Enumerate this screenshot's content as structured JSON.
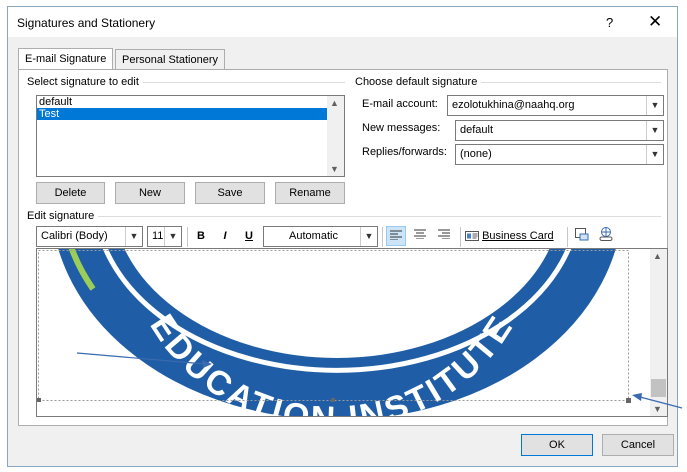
{
  "window": {
    "title": "Signatures and Stationery",
    "help_label": "?",
    "close_label": "✕"
  },
  "tabs": [
    {
      "label": "E-mail Signature",
      "active": true
    },
    {
      "label": "Personal Stationery",
      "active": false
    }
  ],
  "select_signature": {
    "heading": "Select signature to edit",
    "items": [
      {
        "label": "default",
        "selected": false
      },
      {
        "label": "Test",
        "selected": true
      }
    ],
    "buttons": {
      "delete": "Delete",
      "new": "New",
      "save": "Save",
      "rename": "Rename"
    }
  },
  "default_signature": {
    "heading": "Choose default signature",
    "email_account_label": "E-mail account:",
    "email_account_value": "ezolotukhina@naahq.org",
    "new_messages_label": "New messages:",
    "new_messages_value": "default",
    "replies_label": "Replies/forwards:",
    "replies_value": "(none)"
  },
  "edit_signature": {
    "heading": "Edit signature",
    "font_name": "Calibri (Body)",
    "font_size": "11",
    "bold": "B",
    "italic": "I",
    "underline": "U",
    "font_color": "Automatic",
    "business_card_label": "Business Card",
    "image_text": "EDUCATION INSTITUTE"
  },
  "footer": {
    "ok": "OK",
    "cancel": "Cancel"
  },
  "colors": {
    "accent": "#0078d7",
    "logo_blue": "#1f5ea6",
    "logo_green": "#6aa33a",
    "arrow": "#3a6ab0"
  }
}
